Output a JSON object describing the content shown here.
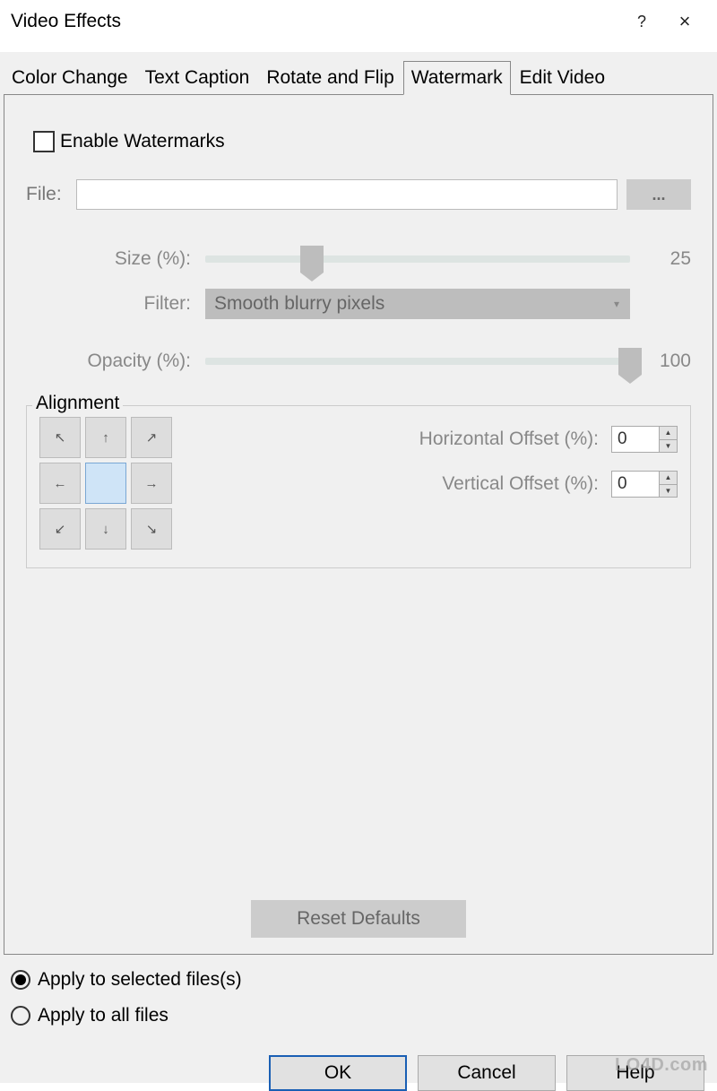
{
  "window": {
    "title": "Video Effects"
  },
  "tabs": {
    "color_change": "Color Change",
    "text_caption": "Text Caption",
    "rotate_flip": "Rotate and Flip",
    "watermark": "Watermark",
    "edit_video": "Edit Video"
  },
  "watermark": {
    "enable_label": "Enable Watermarks",
    "file_label": "File:",
    "file_value": "",
    "browse_label": "...",
    "size_label": "Size (%):",
    "size_value": "25",
    "size_percent": 25,
    "filter_label": "Filter:",
    "filter_value": "Smooth blurry pixels",
    "opacity_label": "Opacity (%):",
    "opacity_value": "100",
    "opacity_percent": 100
  },
  "alignment": {
    "legend": "Alignment",
    "horizontal_label": "Horizontal Offset (%):",
    "horizontal_value": "0",
    "vertical_label": "Vertical Offset (%):",
    "vertical_value": "0"
  },
  "reset_label": "Reset Defaults",
  "apply": {
    "selected_label": "Apply to selected files(s)",
    "all_label": "Apply to all files"
  },
  "buttons": {
    "ok": "OK",
    "cancel": "Cancel",
    "help": "Help"
  },
  "footer_logo": "LO4D.com"
}
